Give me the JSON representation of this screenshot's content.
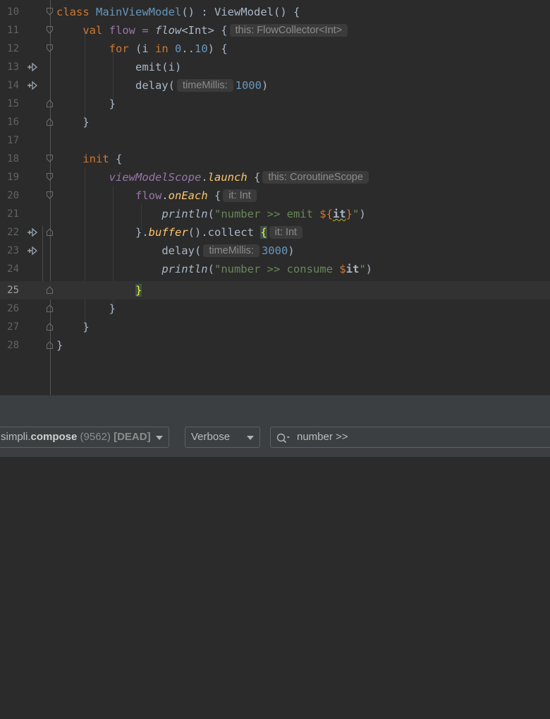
{
  "editor": {
    "lines": [
      {
        "n": "10"
      },
      {
        "n": "11"
      },
      {
        "n": "12"
      },
      {
        "n": "13"
      },
      {
        "n": "14"
      },
      {
        "n": "15"
      },
      {
        "n": "16"
      },
      {
        "n": "17"
      },
      {
        "n": "18"
      },
      {
        "n": "19"
      },
      {
        "n": "20"
      },
      {
        "n": "21"
      },
      {
        "n": "22"
      },
      {
        "n": "23"
      },
      {
        "n": "24"
      },
      {
        "n": "25"
      },
      {
        "n": "26"
      },
      {
        "n": "27"
      },
      {
        "n": "28"
      }
    ],
    "current_line": "25",
    "t": {
      "class_kw": "class",
      "class_name": "MainViewModel",
      "class_rest": "() : ViewModel() {",
      "val_kw": "val",
      "flow_var": " flow = ",
      "flow_fn": "flow",
      "flow_gen": "<Int> {",
      "hint_flow": "this: FlowCollector<Int>",
      "for_kw": "for",
      "for_open": " (i ",
      "in_kw": "in",
      "for_range_a": " 0",
      "for_dots": "..",
      "for_range_b": "10",
      "for_close": ") {",
      "emit": "emit(i)",
      "delay1_a": "delay(",
      "hint_time1": "timeMillis:",
      "delay1_num": "1000",
      "delay1_b": ")",
      "close_brace": "}",
      "init_kw": "init",
      "init_open": " {",
      "scope": "viewModelScope",
      "dot": ".",
      "launch": "launch",
      "launch_open": " {",
      "hint_scope": "this: CoroutineScope",
      "flow2": "flow",
      "onEach": "onEach",
      "onEach_open": " {",
      "hint_it1": "it: Int",
      "println": "println",
      "p_open": "(",
      "str1_a": "\"number >> emit ",
      "str1_tmpl_a": "${",
      "str1_it": "it",
      "str1_tmpl_b": "}",
      "str1_b": "\"",
      "p_close": ")",
      "buf_a": "}.",
      "buffer": "buffer",
      "buf_b": "().collect ",
      "collect_brace": "{",
      "hint_it2": "it: Int",
      "delay2_a": "delay(",
      "hint_time2": "timeMillis:",
      "delay2_num": "3000",
      "delay2_b": ")",
      "str2_a": "\"number >> consume ",
      "str2_dollar": "$",
      "str2_it": "it",
      "str2_b": "\"",
      "cur_brace": "}"
    }
  },
  "toolbar": {
    "process_prefix": "simpli.",
    "process_bold": "compose",
    "process_pid": "(9562)",
    "process_state": "[DEAD]",
    "level": "Verbose",
    "search_value": "number >>"
  },
  "colors": {
    "keyword": "#cc7832",
    "string": "#6a8759",
    "number": "#6897bb",
    "function": "#ffc66d",
    "text": "#a9b7c6",
    "background": "#2b2b2b"
  },
  "icons": [
    "fold-marker-icon",
    "suspend-call-icon",
    "search-icon",
    "dropdown-arrow-icon"
  ]
}
